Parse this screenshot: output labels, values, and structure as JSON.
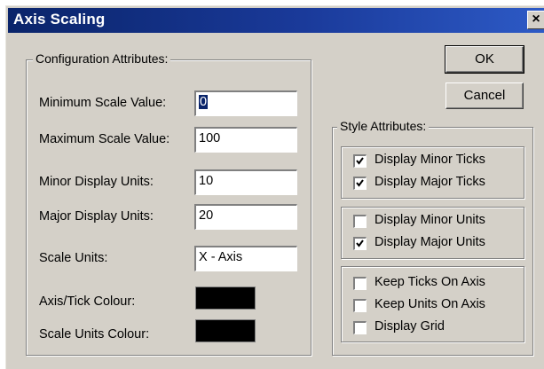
{
  "window": {
    "title": "Axis Scaling",
    "close_glyph": "×"
  },
  "config": {
    "legend": "Configuration Attributes:",
    "min_label": "Minimum Scale Value:",
    "min_value": "0",
    "max_label": "Maximum Scale Value:",
    "max_value": "100",
    "minor_label": "Minor Display Units:",
    "minor_value": "10",
    "major_label": "Major Display Units:",
    "major_value": "20",
    "scale_units_label": "Scale Units:",
    "scale_units_value": "X - Axis",
    "axis_colour_label": "Axis/Tick Colour:",
    "axis_colour": "#000000",
    "scale_colour_label": "Scale Units Colour:",
    "scale_colour": "#000000"
  },
  "buttons": {
    "ok": "OK",
    "cancel": "Cancel"
  },
  "style": {
    "legend": "Style Attributes:",
    "display_minor_ticks": {
      "label": "Display Minor Ticks",
      "checked": true
    },
    "display_major_ticks": {
      "label": "Display Major Ticks",
      "checked": true
    },
    "display_minor_units": {
      "label": "Display Minor Units",
      "checked": false
    },
    "display_major_units": {
      "label": "Display Major Units",
      "checked": true
    },
    "keep_ticks_on_axis": {
      "label": "Keep Ticks On Axis",
      "checked": false
    },
    "keep_units_on_axis": {
      "label": "Keep Units On Axis",
      "checked": false
    },
    "display_grid": {
      "label": "Display Grid",
      "checked": false
    }
  }
}
